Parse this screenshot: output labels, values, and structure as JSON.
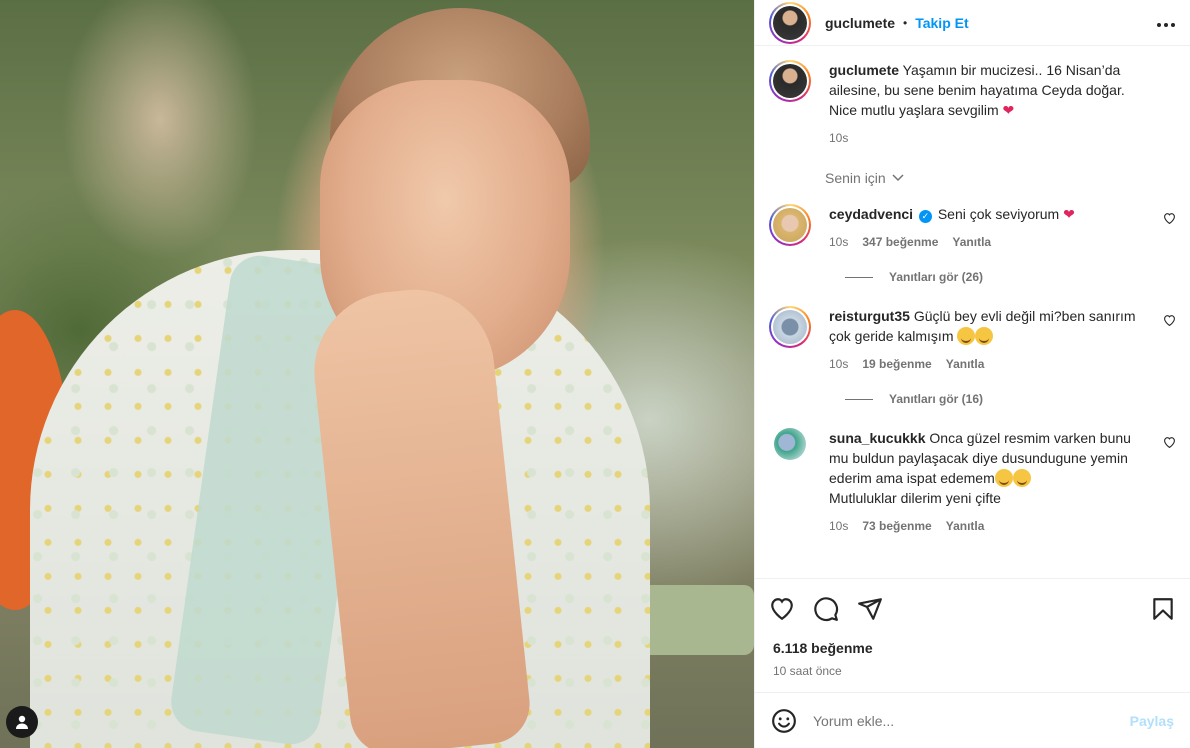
{
  "post": {
    "author": "guclumete",
    "follow_label": "Takip Et",
    "dot": "•",
    "more_label": "•••",
    "caption": {
      "user": "guclumete",
      "text": "Yaşamın bir mucizesi.. 16 Nisan’da ailesine, bu sene benim hayatıma Ceyda doğar. Nice mutlu yaşlara sevgilim",
      "time": "10s"
    },
    "for_you_label": "Senin için",
    "comments": [
      {
        "user": "ceydadvenci",
        "verified": true,
        "text": "Seni çok seviyorum",
        "time": "10s",
        "likes": "347 beğenme",
        "reply": "Yanıtla",
        "view_replies": "Yanıtları gör (26)"
      },
      {
        "user": "reisturgut35",
        "verified": false,
        "text": "Güçlü bey evli değil mi?ben sanırım çok geride kalmışım",
        "time": "10s",
        "likes": "19 beğenme",
        "reply": "Yanıtla",
        "view_replies": "Yanıtları gör (16)"
      },
      {
        "user": "suna_kucukkk",
        "verified": false,
        "text": "Onca güzel resmim varken bunu mu buldun paylaşacak diye dusundugune yemin ederim ama ispat edemem",
        "text_end": "Mutluluklar dilerim yeni çifte",
        "time": "10s",
        "likes": "73 beğenme",
        "reply": "Yanıtla"
      }
    ],
    "likes_total": "6.118 beğenme",
    "posted": "10 saat önce",
    "add_comment_placeholder": "Yorum ekle...",
    "share_label": "Paylaş"
  },
  "icons": {
    "heart": "heart-icon",
    "comment": "comment-icon",
    "share": "send-icon",
    "save": "bookmark-icon",
    "emoji": "emoji-icon",
    "user": "user-tag-icon"
  },
  "colors": {
    "follow_blue": "#0095f6",
    "share_disabled": "#b2dffc",
    "verified_blue": "#0095f6",
    "heart_red": "#e0245e"
  }
}
